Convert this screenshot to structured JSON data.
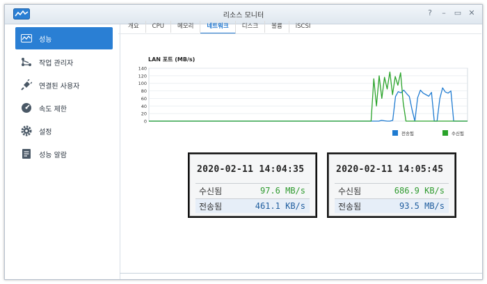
{
  "window": {
    "title": "리소스 모니터"
  },
  "sidebar": {
    "items": [
      {
        "label": "성능",
        "icon": "performance-icon",
        "active": true
      },
      {
        "label": "작업 관리자",
        "icon": "task-manager-icon"
      },
      {
        "label": "연결된 사용자",
        "icon": "plug-icon"
      },
      {
        "label": "속도 제한",
        "icon": "speedometer-icon"
      },
      {
        "label": "설정",
        "icon": "gear-icon"
      },
      {
        "label": "성능 알람",
        "icon": "document-icon"
      }
    ]
  },
  "tabs": [
    {
      "label": "개요"
    },
    {
      "label": "CPU"
    },
    {
      "label": "메모리"
    },
    {
      "label": "네트워크",
      "active": true
    },
    {
      "label": "디스크"
    },
    {
      "label": "볼륨"
    },
    {
      "label": "iSCSI"
    }
  ],
  "chart_data": {
    "type": "line",
    "title": "LAN 포트 (MB/s)",
    "ylim": [
      0,
      140
    ],
    "yticks": [
      140,
      120,
      100,
      80,
      60,
      40,
      20,
      0
    ],
    "grid": true,
    "legend_position": "bottom-right",
    "series": [
      {
        "name": "전송됨",
        "color": "#1f7bd1",
        "values": [
          0,
          0,
          0,
          0,
          0,
          0,
          0,
          0,
          0,
          0,
          0,
          0,
          0,
          0,
          0,
          0,
          0,
          0,
          0,
          0,
          0,
          0,
          0,
          0,
          0,
          0,
          0,
          0,
          0,
          0,
          0,
          0,
          0,
          0,
          0,
          0,
          0,
          0,
          0,
          0,
          0,
          0,
          0,
          0,
          0,
          0,
          0,
          0,
          0,
          0,
          0,
          0,
          0,
          0,
          0,
          0,
          0,
          0,
          0,
          0,
          0,
          0,
          0,
          0,
          0,
          0,
          0,
          0,
          0,
          0,
          0,
          0,
          0,
          0,
          0,
          0,
          0,
          0,
          0,
          0,
          0,
          0,
          0,
          0,
          2,
          1,
          0,
          0,
          2,
          65,
          78,
          75,
          82,
          73,
          65,
          30,
          0,
          62,
          82,
          74,
          70,
          66,
          76,
          0,
          0,
          60,
          88,
          77,
          74,
          80,
          0,
          0,
          0,
          0,
          0,
          0
        ]
      },
      {
        "name": "수신됨",
        "color": "#2aa32a",
        "values": [
          0,
          0,
          0,
          0,
          0,
          0,
          0,
          0,
          0,
          0,
          0,
          0,
          0,
          0,
          0,
          0,
          0,
          0,
          0,
          0,
          0,
          0,
          0,
          0,
          0,
          0,
          0,
          0,
          0,
          0,
          0,
          0,
          0,
          0,
          0,
          0,
          0,
          0,
          0,
          0,
          0,
          0,
          0,
          0,
          0,
          0,
          0,
          0,
          0,
          0,
          0,
          0,
          0,
          0,
          0,
          0,
          0,
          0,
          0,
          0,
          0,
          0,
          0,
          0,
          0,
          0,
          0,
          0,
          0,
          0,
          0,
          0,
          0,
          0,
          0,
          0,
          0,
          0,
          0,
          0,
          0,
          0,
          0,
          0,
          112,
          40,
          120,
          60,
          116,
          85,
          130,
          70,
          118,
          95,
          128,
          48,
          0,
          0,
          0,
          0,
          0,
          0,
          0,
          0,
          0,
          0,
          0,
          0,
          0,
          0,
          0,
          0,
          0,
          0,
          0,
          0,
          0,
          0,
          0,
          0
        ]
      }
    ]
  },
  "panels": [
    {
      "timestamp": "2020-02-11 14:04:35",
      "rx_label": "수신됨",
      "rx_value": "97.6 MB/s",
      "tx_label": "전송됨",
      "tx_value": "461.1 KB/s"
    },
    {
      "timestamp": "2020-02-11 14:05:45",
      "rx_label": "수신됨",
      "rx_value": "686.9 KB/s",
      "tx_label": "전송됨",
      "tx_value": "93.5 MB/s"
    }
  ]
}
